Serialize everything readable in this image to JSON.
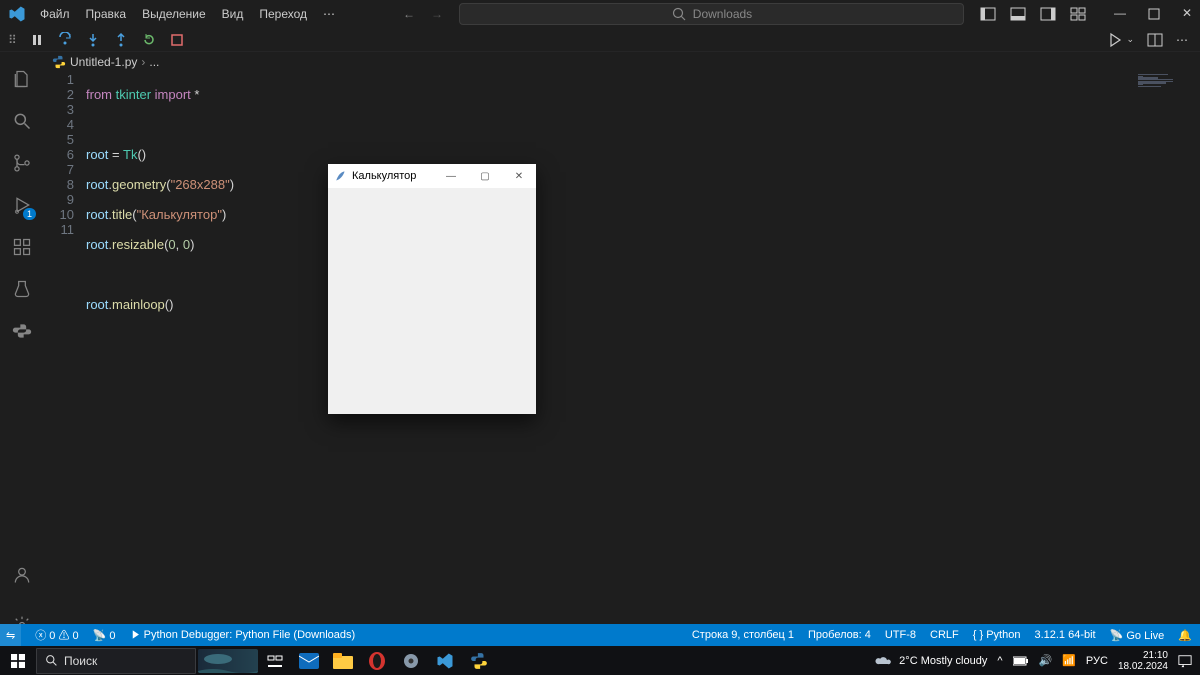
{
  "titlebar": {
    "menus": [
      "Файл",
      "Правка",
      "Выделение",
      "Вид",
      "Переход"
    ],
    "search_label": "Downloads"
  },
  "tab": {
    "filename": "Untitled-1.py",
    "crumb_tail": "..."
  },
  "line_numbers": [
    "1",
    "2",
    "3",
    "4",
    "5",
    "6",
    "7",
    "8",
    "9",
    "10",
    "11"
  ],
  "code_lines": {
    "l1": {
      "from": "from",
      "mod": "tkinter",
      "imp": "import",
      "star": "*"
    },
    "l3": {
      "var": "root",
      "eq": " = ",
      "cls": "Tk",
      "call": "()"
    },
    "l4": {
      "var": "root",
      "dot": ".",
      "fn": "geometry",
      "open": "(",
      "str": "\"268x288\"",
      "close": ")"
    },
    "l5": {
      "var": "root",
      "dot": ".",
      "fn": "title",
      "open": "(",
      "str": "\"Калькулятор\"",
      "close": ")"
    },
    "l6": {
      "var": "root",
      "dot": ".",
      "fn": "resizable",
      "open": "(",
      "n1": "0",
      "comma": ", ",
      "n2": "0",
      "close": ")"
    },
    "l8": {
      "var": "root",
      "dot": ".",
      "fn": "mainloop",
      "call": "()"
    }
  },
  "tkwin": {
    "title": "Калькулятор"
  },
  "statusbar": {
    "remote": "⇋",
    "errors": "0",
    "warnings": "0",
    "ports_icon": "📡",
    "ports": "0",
    "debugger": "Python Debugger: Python File (Downloads)",
    "cursor": "Строка 9, столбец 1",
    "spaces": "Пробелов: 4",
    "encoding": "UTF-8",
    "eol": "CRLF",
    "lang": "Python",
    "interpreter": "3.12.1 64-bit",
    "golive": "Go Live"
  },
  "taskbar": {
    "search_placeholder": "Поиск",
    "weather": "2°C  Mostly cloudy",
    "lang": "РУС",
    "time": "21:10",
    "date": "18.02.2024"
  },
  "activity_badge": "1"
}
